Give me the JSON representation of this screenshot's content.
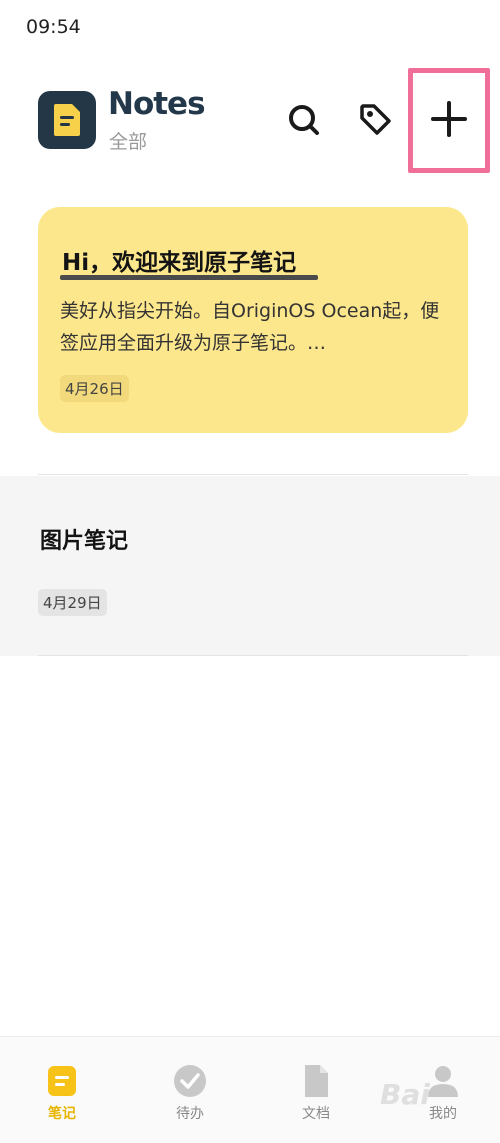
{
  "status_bar": {
    "time": "09:54"
  },
  "header": {
    "title": "Notes",
    "subtitle": "全部",
    "icons": {
      "search": "search-icon",
      "tag": "tag-icon",
      "add": "plus-icon"
    },
    "highlight_color": "#ef6f99"
  },
  "notes": [
    {
      "title": "Hi，欢迎来到原子笔记",
      "preview": "美好从指尖开始。自OriginOS Ocean起，便签应用全面升级为原子笔记。…",
      "date": "4月26日",
      "color": "#fde78d"
    },
    {
      "title": "图片笔记",
      "date": "4月29日",
      "color": "#f5f5f5"
    }
  ],
  "bottom_nav": {
    "items": [
      {
        "label": "笔记",
        "icon": "note-icon",
        "active": true
      },
      {
        "label": "待办",
        "icon": "check-circle-icon",
        "active": false
      },
      {
        "label": "文档",
        "icon": "document-icon",
        "active": false
      },
      {
        "label": "我的",
        "icon": "person-icon",
        "active": false
      }
    ],
    "active_color": "#e8b400"
  },
  "watermark": "Bai"
}
